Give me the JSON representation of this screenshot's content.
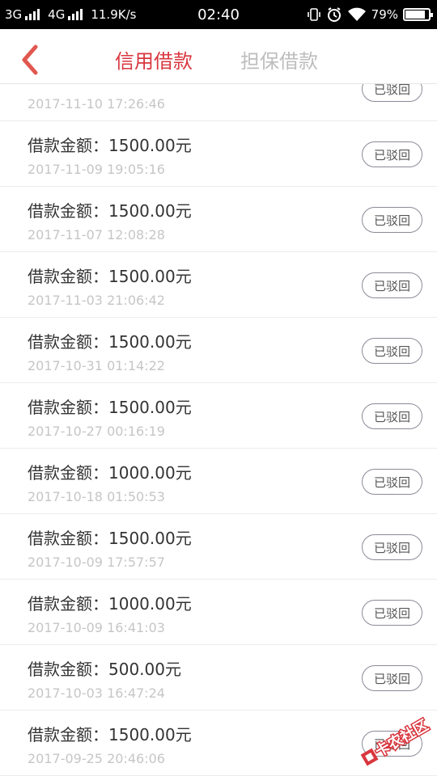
{
  "status_bar": {
    "net1": "3G",
    "net2": "4G",
    "speed": "11.9K/s",
    "time": "02:40",
    "battery": "79%",
    "icons": [
      "vibrate-icon",
      "alarm-icon",
      "wifi-icon",
      "battery-icon"
    ]
  },
  "header": {
    "back_icon": "chevron-left-icon",
    "tab_active": "信用借款",
    "tab_inactive": "担保借款",
    "accent": "#d9363e",
    "inactive_color": "#bdbdbd"
  },
  "partial_item": {
    "datetime": "2017-11-10 17:26:46",
    "status": "已驳回"
  },
  "items": [
    {
      "amount": "借款金额：1500.00元",
      "datetime": "2017-11-09 19:05:16",
      "status": "已驳回"
    },
    {
      "amount": "借款金额：1500.00元",
      "datetime": "2017-11-07 12:08:28",
      "status": "已驳回"
    },
    {
      "amount": "借款金额：1500.00元",
      "datetime": "2017-11-03 21:06:42",
      "status": "已驳回"
    },
    {
      "amount": "借款金额：1500.00元",
      "datetime": "2017-10-31 01:14:22",
      "status": "已驳回"
    },
    {
      "amount": "借款金额：1500.00元",
      "datetime": "2017-10-27 00:16:19",
      "status": "已驳回"
    },
    {
      "amount": "借款金额：1000.00元",
      "datetime": "2017-10-18 01:50:53",
      "status": "已驳回"
    },
    {
      "amount": "借款金额：1500.00元",
      "datetime": "2017-10-09 17:57:57",
      "status": "已驳回"
    },
    {
      "amount": "借款金额：1000.00元",
      "datetime": "2017-10-09 16:41:03",
      "status": "已驳回"
    },
    {
      "amount": "借款金额：500.00元",
      "datetime": "2017-10-03 16:47:24",
      "status": "已驳回"
    },
    {
      "amount": "借款金额：1500.00元",
      "datetime": "2017-09-25 20:46:06",
      "status": "已驳回"
    }
  ],
  "watermark": {
    "text": "卡农社区",
    "color": "#d9363e"
  }
}
